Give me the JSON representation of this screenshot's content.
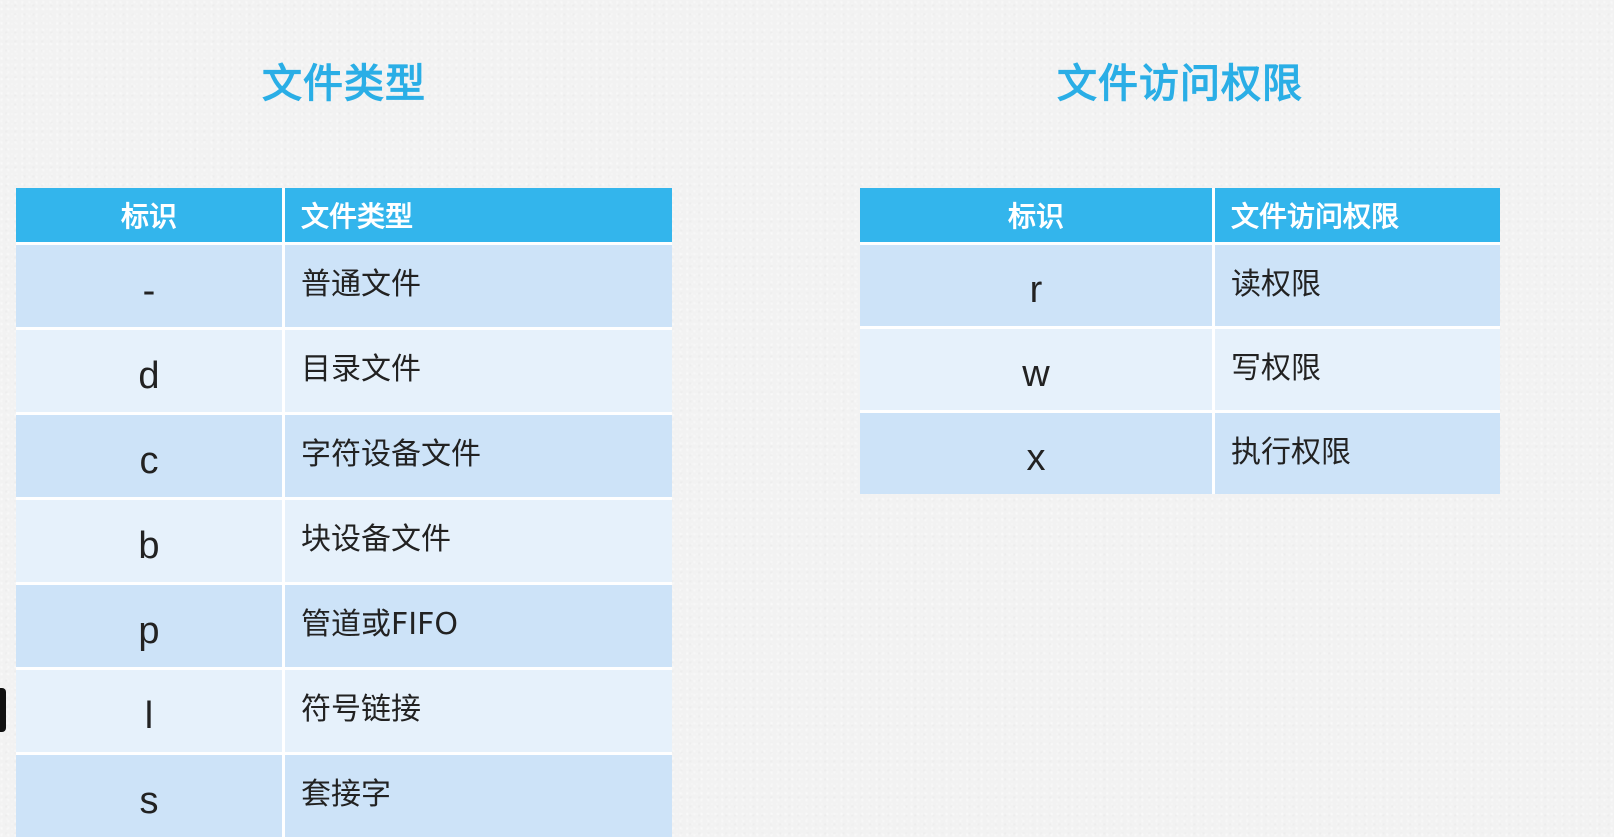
{
  "left_panel": {
    "title": "文件类型",
    "table": {
      "headers": [
        "标识",
        "文件类型"
      ],
      "rows": [
        {
          "id": "-",
          "desc": "普通文件"
        },
        {
          "id": "d",
          "desc": "目录文件"
        },
        {
          "id": "c",
          "desc": "字符设备文件"
        },
        {
          "id": "b",
          "desc": "块设备文件"
        },
        {
          "id": "p",
          "desc": "管道或FIFO"
        },
        {
          "id": "l",
          "desc": "符号链接"
        },
        {
          "id": "s",
          "desc": "套接字"
        }
      ]
    }
  },
  "right_panel": {
    "title": "文件访问权限",
    "table": {
      "headers": [
        "标识",
        "文件访问权限"
      ],
      "rows": [
        {
          "id": "r",
          "desc": "读权限"
        },
        {
          "id": "w",
          "desc": "写权限"
        },
        {
          "id": "x",
          "desc": "执行权限"
        }
      ]
    }
  },
  "colors": {
    "title": "#2aaee6",
    "header_bg": "#33b5ec",
    "row_dark": "#cde3f8",
    "row_light": "#e6f1fb",
    "background": "#f2f2f2"
  }
}
